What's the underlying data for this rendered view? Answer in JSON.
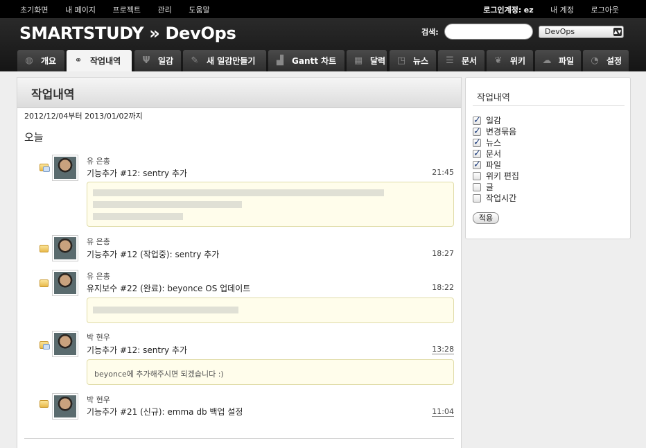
{
  "top_menu": {
    "left": [
      "초기화면",
      "내 페이지",
      "프로젝트",
      "관리",
      "도움말"
    ],
    "login_label": "로그인계정:",
    "login_user": "ez",
    "my_account": "내 계정",
    "logout": "로그아웃"
  },
  "header": {
    "title": "SMARTSTUDY » DevOps",
    "search_label": "검색:",
    "search_value": "",
    "project_selected": "DevOps"
  },
  "tabs": [
    {
      "label": "개요",
      "icon": "globe-icon"
    },
    {
      "label": "작업내역",
      "icon": "binoculars-icon",
      "selected": true
    },
    {
      "label": "일감",
      "icon": "utensils-icon"
    },
    {
      "label": "새 일감만들기",
      "icon": "pen-icon"
    },
    {
      "label": "Gantt 차트",
      "icon": "bar-chart-icon"
    },
    {
      "label": "달력",
      "icon": "calendar-icon"
    },
    {
      "label": "뉴스",
      "icon": "rss-icon"
    },
    {
      "label": "문서",
      "icon": "stack-icon"
    },
    {
      "label": "위키",
      "icon": "feather-icon"
    },
    {
      "label": "파일",
      "icon": "cloud-upload-icon"
    },
    {
      "label": "설정",
      "icon": "gauge-icon"
    }
  ],
  "content": {
    "title": "작업내역",
    "date_range": "2012/12/04부터 2013/01/02까지",
    "day_heading": "오늘",
    "events": [
      {
        "author": "유 은총",
        "title": "기능추가 #12: sentry 추가",
        "time": "21:45",
        "underlined": false,
        "icon": "comment-icon",
        "description": ""
      },
      {
        "author": "유 은총",
        "title": "기능추가 #12 (작업중): sentry 추가",
        "time": "18:27",
        "underlined": false,
        "icon": "edit-icon",
        "description": ""
      },
      {
        "author": "유 은총",
        "title": "유지보수 #22 (완료): beyonce OS 업데이트",
        "time": "18:22",
        "underlined": false,
        "icon": "ticket-icon",
        "description": ""
      },
      {
        "author": "박 현우",
        "title": "기능추가 #12: sentry 추가",
        "time": "13:28",
        "underlined": true,
        "icon": "comment-icon",
        "description": "beyonce에 추가해주시면 되겠습니다 :)"
      },
      {
        "author": "박 현우",
        "title": "기능추가 #21 (신규): emma db 백업 설정",
        "time": "11:04",
        "underlined": true,
        "icon": "ticket-icon",
        "description": ""
      }
    ]
  },
  "sidebar": {
    "title": "작업내역",
    "filters": [
      {
        "label": "일감",
        "checked": true
      },
      {
        "label": "변경묶음",
        "checked": true
      },
      {
        "label": "뉴스",
        "checked": true
      },
      {
        "label": "문서",
        "checked": true
      },
      {
        "label": "파일",
        "checked": true
      },
      {
        "label": "위키 편집",
        "checked": false
      },
      {
        "label": "글",
        "checked": false
      },
      {
        "label": "작업시간",
        "checked": false
      }
    ],
    "apply_label": "적용"
  }
}
